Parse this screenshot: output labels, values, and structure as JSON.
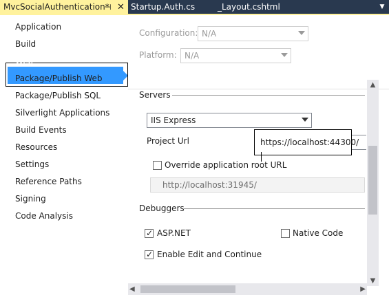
{
  "tabs": [
    {
      "label": "MvcSocialAuthentication*",
      "pin_icon": "pin-icon",
      "close_icon": "close-icon"
    },
    {
      "label": "Startup.Auth.cs"
    },
    {
      "label": "_Layout.cshtml"
    }
  ],
  "nav": {
    "items": [
      "Application",
      "Build",
      "Web*",
      "Package/Publish Web",
      "Package/Publish SQL",
      "Silverlight Applications",
      "Build Events",
      "Resources",
      "Settings",
      "Reference Paths",
      "Signing",
      "Code Analysis"
    ],
    "selected_index": 2
  },
  "config": {
    "configuration_label": "Configuration:",
    "configuration_value": "N/A",
    "platform_label": "Platform:",
    "platform_value": "N/A"
  },
  "servers": {
    "heading": "Servers",
    "server_value": "IIS Express",
    "project_url_label": "Project Url",
    "project_url_value": "https://localhost:44300/",
    "override_label": "Override application root URL",
    "override_checked": false,
    "override_value": "http://localhost:31945/"
  },
  "debuggers": {
    "heading": "Debuggers",
    "aspnet_label": "ASP.NET",
    "aspnet_checked": true,
    "native_label": "Native Code",
    "native_checked": false,
    "edit_continue_label": "Enable Edit and Continue",
    "edit_continue_checked": true
  },
  "colors": {
    "tab_active": "#fff29d",
    "tabstrip": "#29394f",
    "selection": "#3399ff"
  }
}
